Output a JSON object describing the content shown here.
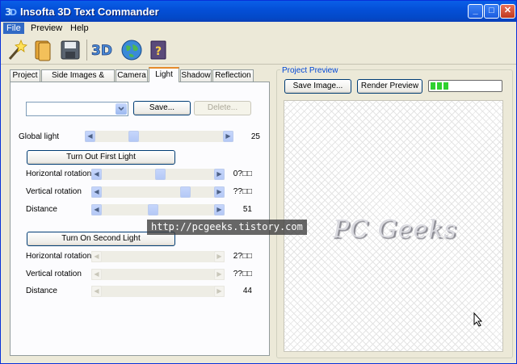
{
  "window": {
    "title": "Insofta 3D Text Commander",
    "controls": {
      "minimize": "_",
      "maximize": "□",
      "close": "✕"
    }
  },
  "menu": {
    "items": [
      "File",
      "Preview",
      "Help"
    ]
  },
  "toolbar": {
    "tools": [
      "magic-wand-icon",
      "open-folder-icon",
      "save-disk-icon",
      "3d-logo-icon",
      "globe-icon",
      "help-book-icon"
    ]
  },
  "tabs": [
    "Project",
    "Side Images & Colors",
    "Camera",
    "Light",
    "Shadow",
    "Reflection"
  ],
  "active_tab": "Light",
  "light": {
    "preset_value": "",
    "save_label": "Save...",
    "delete_label": "Delete...",
    "global_light": {
      "label": "Global light",
      "value": "25",
      "level": 0.28
    },
    "first_light": {
      "button_label": "Turn Out First Light",
      "horizontal": {
        "label": "Horizontal rotation",
        "value": "0?□□",
        "level": 0.52
      },
      "vertical": {
        "label": "Vertical rotation",
        "value": "??□□",
        "level": 0.77
      },
      "distance": {
        "label": "Distance",
        "value": "51",
        "level": 0.45
      }
    },
    "second_light": {
      "button_label": "Turn On Second Light",
      "horizontal": {
        "label": "Horizontal rotation",
        "value": "2?□□"
      },
      "vertical": {
        "label": "Vertical rotation",
        "value": "??□□"
      },
      "distance": {
        "label": "Distance",
        "value": "44"
      }
    }
  },
  "preview": {
    "group_title": "Project Preview",
    "save_image_label": "Save Image...",
    "render_label": "Render Preview",
    "progress": 0.28,
    "preview_text": "PC Geeks"
  },
  "watermark": "http://pcgeeks.tistory.com",
  "colors": {
    "titlebar": "#0450d8",
    "accent_tab": "#e68b2c",
    "group_title": "#0046d5",
    "progress": "#2fd12f"
  }
}
